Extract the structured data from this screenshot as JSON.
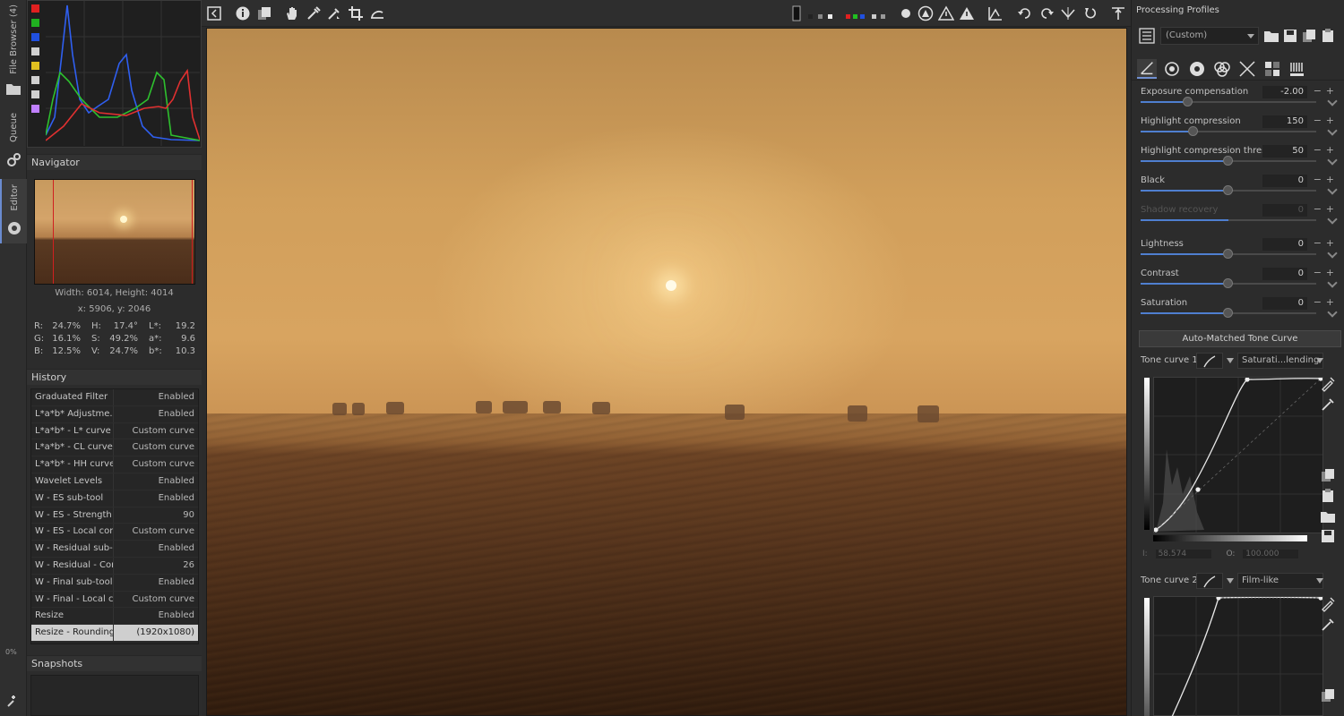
{
  "left_strip": {
    "tabs": [
      {
        "label": "File Browser (4)"
      },
      {
        "label": "Queue"
      },
      {
        "label": "Editor"
      }
    ],
    "percent": "0%"
  },
  "histogram": {
    "channel_colors": [
      "#e02020",
      "#20b020",
      "#2050e0",
      "#d0d0d0",
      "#e0c020",
      "#d0d0d0",
      "#d0d0d0",
      "#c080ff"
    ]
  },
  "navigator": {
    "title": "Navigator",
    "size_text": "Width: 6014, Height: 4014",
    "pos_text": "x: 5906, y: 2046",
    "pixel": [
      [
        "R:",
        "24.7%",
        "H:",
        "17.4°",
        "L*:",
        "19.2"
      ],
      [
        "G:",
        "16.1%",
        "S:",
        "49.2%",
        "a*:",
        "9.6"
      ],
      [
        "B:",
        "12.5%",
        "V:",
        "24.7%",
        "b*:",
        "10.3"
      ]
    ]
  },
  "history": {
    "title": "History",
    "rows": [
      {
        "name": "Graduated Filter",
        "value": "Enabled"
      },
      {
        "name": "L*a*b* Adjustme...",
        "value": "Enabled"
      },
      {
        "name": "L*a*b* - L* curve",
        "value": "Custom curve"
      },
      {
        "name": "L*a*b* - CL curve",
        "value": "Custom curve"
      },
      {
        "name": "L*a*b* - HH curve",
        "value": "Custom curve"
      },
      {
        "name": "Wavelet Levels",
        "value": "Enabled"
      },
      {
        "name": "W - ES sub-tool",
        "value": "Enabled"
      },
      {
        "name": "W - ES - Strength",
        "value": "90"
      },
      {
        "name": "W - ES - Local con...",
        "value": "Custom curve"
      },
      {
        "name": "W - Residual sub-t...",
        "value": "Enabled"
      },
      {
        "name": "W - Residual - Con...",
        "value": "26"
      },
      {
        "name": "W - Final sub-tool",
        "value": "Enabled"
      },
      {
        "name": "W - Final - Local c...",
        "value": "Custom curve"
      },
      {
        "name": "Resize",
        "value": "Enabled"
      },
      {
        "name": "Resize - Rounding...",
        "value": "(1920x1080)"
      }
    ],
    "selected_index": 14
  },
  "snapshots": {
    "title": "Snapshots"
  },
  "right_panel": {
    "title": "Processing Profiles",
    "profile_value": "(Custom)",
    "params": [
      {
        "label": "Exposure compensation",
        "value": "-2.00",
        "position": 0.27,
        "disabled": false
      },
      {
        "label": "Highlight compression",
        "value": "150",
        "position": 0.3,
        "disabled": false
      },
      {
        "label": "Highlight compression threshold",
        "value": "50",
        "position": 0.5,
        "disabled": false
      },
      {
        "label": "Black",
        "value": "0",
        "position": 0.5,
        "disabled": false
      },
      {
        "label": "Shadow recovery",
        "value": "0",
        "position": 0.5,
        "disabled": true
      },
      {
        "label": "Lightness",
        "value": "0",
        "position": 0.5,
        "disabled": false
      },
      {
        "label": "Contrast",
        "value": "0",
        "position": 0.5,
        "disabled": false
      },
      {
        "label": "Saturation",
        "value": "0",
        "position": 0.5,
        "disabled": false
      }
    ],
    "auto_matched_label": "Auto-Matched Tone Curve",
    "tone_curve_1": {
      "label": "Tone curve 1:",
      "mode": "Saturati...lending"
    },
    "tone_curve_2": {
      "label": "Tone curve 2:",
      "mode": "Film-like"
    },
    "io": {
      "i_label": "I:",
      "i_value": "58.574",
      "o_label": "O:",
      "o_value": "100.000"
    }
  }
}
